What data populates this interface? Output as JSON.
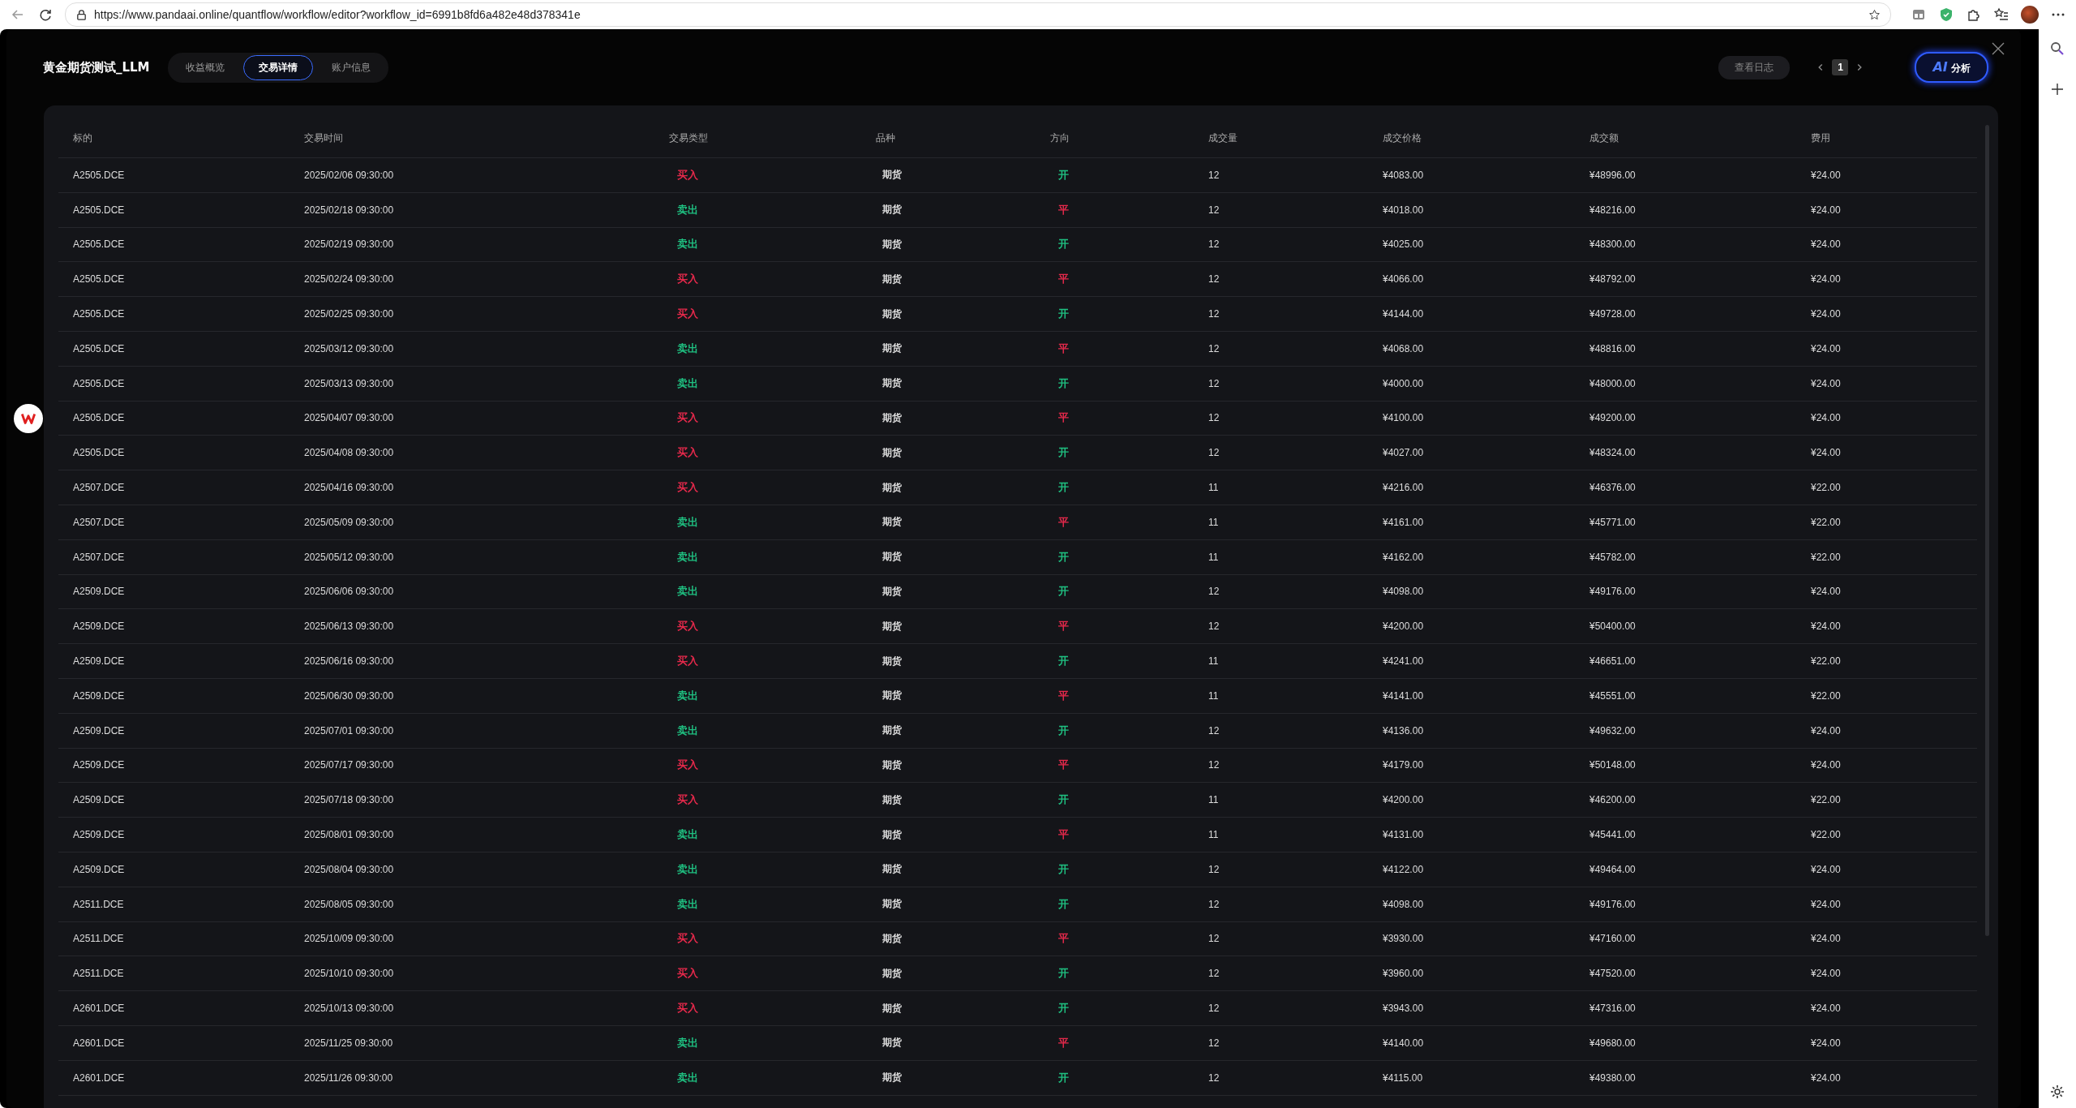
{
  "browser": {
    "url": "https://www.pandaai.online/quantflow/workflow/editor?workflow_id=6991b8fd6a482e48d378341e"
  },
  "title": "黄金期货测试_LLM",
  "tabs": [
    {
      "label": "收益概览",
      "selected": false
    },
    {
      "label": "交易详情",
      "selected": true
    },
    {
      "label": "账户信息",
      "selected": false
    }
  ],
  "log_button": "查看日志",
  "pagination": {
    "current": "1"
  },
  "ai_button": {
    "badge": "AI",
    "label": "分析"
  },
  "table": {
    "columns": [
      "标的",
      "交易时间",
      "交易类型",
      "品种",
      "方向",
      "成交量",
      "成交价格",
      "成交额",
      "费用"
    ],
    "rows": [
      {
        "cells": [
          "A2505.DCE",
          "2025/02/06 09:30:00",
          {
            "text": "买入",
            "color": "#e5294b"
          },
          "期货",
          {
            "text": "开",
            "color": "#1fbf80"
          },
          "12",
          "¥4083.00",
          "¥48996.00",
          "¥24.00"
        ]
      },
      {
        "cells": [
          "A2505.DCE",
          "2025/02/18 09:30:00",
          {
            "text": "卖出",
            "color": "#1fbf80"
          },
          "期货",
          {
            "text": "平",
            "color": "#e5294b"
          },
          "12",
          "¥4018.00",
          "¥48216.00",
          "¥24.00"
        ]
      },
      {
        "cells": [
          "A2505.DCE",
          "2025/02/19 09:30:00",
          {
            "text": "卖出",
            "color": "#1fbf80"
          },
          "期货",
          {
            "text": "开",
            "color": "#1fbf80"
          },
          "12",
          "¥4025.00",
          "¥48300.00",
          "¥24.00"
        ]
      },
      {
        "cells": [
          "A2505.DCE",
          "2025/02/24 09:30:00",
          {
            "text": "买入",
            "color": "#e5294b"
          },
          "期货",
          {
            "text": "平",
            "color": "#e5294b"
          },
          "12",
          "¥4066.00",
          "¥48792.00",
          "¥24.00"
        ]
      },
      {
        "cells": [
          "A2505.DCE",
          "2025/02/25 09:30:00",
          {
            "text": "买入",
            "color": "#e5294b"
          },
          "期货",
          {
            "text": "开",
            "color": "#1fbf80"
          },
          "12",
          "¥4144.00",
          "¥49728.00",
          "¥24.00"
        ]
      },
      {
        "cells": [
          "A2505.DCE",
          "2025/03/12 09:30:00",
          {
            "text": "卖出",
            "color": "#1fbf80"
          },
          "期货",
          {
            "text": "平",
            "color": "#e5294b"
          },
          "12",
          "¥4068.00",
          "¥48816.00",
          "¥24.00"
        ]
      },
      {
        "cells": [
          "A2505.DCE",
          "2025/03/13 09:30:00",
          {
            "text": "卖出",
            "color": "#1fbf80"
          },
          "期货",
          {
            "text": "开",
            "color": "#1fbf80"
          },
          "12",
          "¥4000.00",
          "¥48000.00",
          "¥24.00"
        ]
      },
      {
        "cells": [
          "A2505.DCE",
          "2025/04/07 09:30:00",
          {
            "text": "买入",
            "color": "#e5294b"
          },
          "期货",
          {
            "text": "平",
            "color": "#e5294b"
          },
          "12",
          "¥4100.00",
          "¥49200.00",
          "¥24.00"
        ]
      },
      {
        "cells": [
          "A2505.DCE",
          "2025/04/08 09:30:00",
          {
            "text": "买入",
            "color": "#e5294b"
          },
          "期货",
          {
            "text": "开",
            "color": "#1fbf80"
          },
          "12",
          "¥4027.00",
          "¥48324.00",
          "¥24.00"
        ]
      },
      {
        "cells": [
          "A2507.DCE",
          "2025/04/16 09:30:00",
          {
            "text": "买入",
            "color": "#e5294b"
          },
          "期货",
          {
            "text": "开",
            "color": "#1fbf80"
          },
          "11",
          "¥4216.00",
          "¥46376.00",
          "¥22.00"
        ]
      },
      {
        "cells": [
          "A2507.DCE",
          "2025/05/09 09:30:00",
          {
            "text": "卖出",
            "color": "#1fbf80"
          },
          "期货",
          {
            "text": "平",
            "color": "#e5294b"
          },
          "11",
          "¥4161.00",
          "¥45771.00",
          "¥22.00"
        ]
      },
      {
        "cells": [
          "A2507.DCE",
          "2025/05/12 09:30:00",
          {
            "text": "卖出",
            "color": "#1fbf80"
          },
          "期货",
          {
            "text": "开",
            "color": "#1fbf80"
          },
          "11",
          "¥4162.00",
          "¥45782.00",
          "¥22.00"
        ]
      },
      {
        "cells": [
          "A2509.DCE",
          "2025/06/06 09:30:00",
          {
            "text": "卖出",
            "color": "#1fbf80"
          },
          "期货",
          {
            "text": "开",
            "color": "#1fbf80"
          },
          "12",
          "¥4098.00",
          "¥49176.00",
          "¥24.00"
        ]
      },
      {
        "cells": [
          "A2509.DCE",
          "2025/06/13 09:30:00",
          {
            "text": "买入",
            "color": "#e5294b"
          },
          "期货",
          {
            "text": "平",
            "color": "#e5294b"
          },
          "12",
          "¥4200.00",
          "¥50400.00",
          "¥24.00"
        ]
      },
      {
        "cells": [
          "A2509.DCE",
          "2025/06/16 09:30:00",
          {
            "text": "买入",
            "color": "#e5294b"
          },
          "期货",
          {
            "text": "开",
            "color": "#1fbf80"
          },
          "11",
          "¥4241.00",
          "¥46651.00",
          "¥22.00"
        ]
      },
      {
        "cells": [
          "A2509.DCE",
          "2025/06/30 09:30:00",
          {
            "text": "卖出",
            "color": "#1fbf80"
          },
          "期货",
          {
            "text": "平",
            "color": "#e5294b"
          },
          "11",
          "¥4141.00",
          "¥45551.00",
          "¥22.00"
        ]
      },
      {
        "cells": [
          "A2509.DCE",
          "2025/07/01 09:30:00",
          {
            "text": "卖出",
            "color": "#1fbf80"
          },
          "期货",
          {
            "text": "开",
            "color": "#1fbf80"
          },
          "12",
          "¥4136.00",
          "¥49632.00",
          "¥24.00"
        ]
      },
      {
        "cells": [
          "A2509.DCE",
          "2025/07/17 09:30:00",
          {
            "text": "买入",
            "color": "#e5294b"
          },
          "期货",
          {
            "text": "平",
            "color": "#e5294b"
          },
          "12",
          "¥4179.00",
          "¥50148.00",
          "¥24.00"
        ]
      },
      {
        "cells": [
          "A2509.DCE",
          "2025/07/18 09:30:00",
          {
            "text": "买入",
            "color": "#e5294b"
          },
          "期货",
          {
            "text": "开",
            "color": "#1fbf80"
          },
          "11",
          "¥4200.00",
          "¥46200.00",
          "¥22.00"
        ]
      },
      {
        "cells": [
          "A2509.DCE",
          "2025/08/01 09:30:00",
          {
            "text": "卖出",
            "color": "#1fbf80"
          },
          "期货",
          {
            "text": "平",
            "color": "#e5294b"
          },
          "11",
          "¥4131.00",
          "¥45441.00",
          "¥22.00"
        ]
      },
      {
        "cells": [
          "A2509.DCE",
          "2025/08/04 09:30:00",
          {
            "text": "卖出",
            "color": "#1fbf80"
          },
          "期货",
          {
            "text": "开",
            "color": "#1fbf80"
          },
          "12",
          "¥4122.00",
          "¥49464.00",
          "¥24.00"
        ]
      },
      {
        "cells": [
          "A2511.DCE",
          "2025/08/05 09:30:00",
          {
            "text": "卖出",
            "color": "#1fbf80"
          },
          "期货",
          {
            "text": "开",
            "color": "#1fbf80"
          },
          "12",
          "¥4098.00",
          "¥49176.00",
          "¥24.00"
        ]
      },
      {
        "cells": [
          "A2511.DCE",
          "2025/10/09 09:30:00",
          {
            "text": "买入",
            "color": "#e5294b"
          },
          "期货",
          {
            "text": "平",
            "color": "#e5294b"
          },
          "12",
          "¥3930.00",
          "¥47160.00",
          "¥24.00"
        ]
      },
      {
        "cells": [
          "A2511.DCE",
          "2025/10/10 09:30:00",
          {
            "text": "买入",
            "color": "#e5294b"
          },
          "期货",
          {
            "text": "开",
            "color": "#1fbf80"
          },
          "12",
          "¥3960.00",
          "¥47520.00",
          "¥24.00"
        ]
      },
      {
        "cells": [
          "A2601.DCE",
          "2025/10/13 09:30:00",
          {
            "text": "买入",
            "color": "#e5294b"
          },
          "期货",
          {
            "text": "开",
            "color": "#1fbf80"
          },
          "12",
          "¥3943.00",
          "¥47316.00",
          "¥24.00"
        ]
      },
      {
        "cells": [
          "A2601.DCE",
          "2025/11/25 09:30:00",
          {
            "text": "卖出",
            "color": "#1fbf80"
          },
          "期货",
          {
            "text": "平",
            "color": "#e5294b"
          },
          "12",
          "¥4140.00",
          "¥49680.00",
          "¥24.00"
        ]
      },
      {
        "cells": [
          "A2601.DCE",
          "2025/11/26 09:30:00",
          {
            "text": "卖出",
            "color": "#1fbf80"
          },
          "期货",
          {
            "text": "开",
            "color": "#1fbf80"
          },
          "12",
          "¥4115.00",
          "¥49380.00",
          "¥24.00"
        ]
      }
    ]
  }
}
